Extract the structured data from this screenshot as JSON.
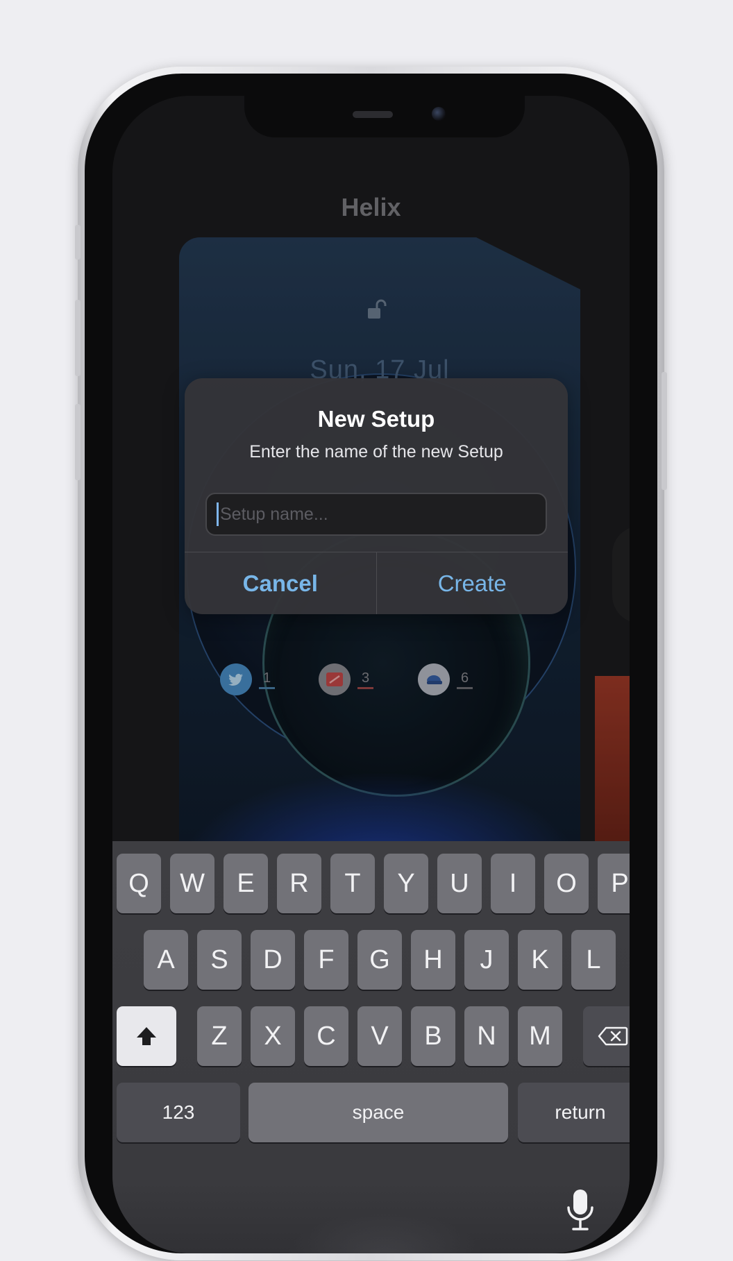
{
  "app": {
    "title": "Helix"
  },
  "lock_card": {
    "date": "Sun, 17 Jul"
  },
  "badges": [
    {
      "icon": "bird-icon",
      "count": "1",
      "color": "#5aa3dc",
      "underline": "#4a7fa8"
    },
    {
      "icon": "news-icon",
      "count": "3",
      "color": "#c84a4a",
      "underline": "#a04a4a"
    },
    {
      "icon": "browser-icon",
      "count": "6",
      "color": "#9aa6bd",
      "underline": "#6d6d72"
    }
  ],
  "dialog": {
    "title": "New Setup",
    "message": "Enter the name of the new Setup",
    "input": {
      "value": "",
      "placeholder": "Setup name..."
    },
    "cancel_label": "Cancel",
    "create_label": "Create"
  },
  "keyboard": {
    "row1": [
      "Q",
      "W",
      "E",
      "R",
      "T",
      "Y",
      "U",
      "I",
      "O",
      "P"
    ],
    "row2": [
      "A",
      "S",
      "D",
      "F",
      "G",
      "H",
      "J",
      "K",
      "L"
    ],
    "row3": [
      "Z",
      "X",
      "C",
      "V",
      "B",
      "N",
      "M"
    ],
    "numbers_label": "123",
    "space_label": "space",
    "return_label": "return",
    "shift_icon": "shift-icon",
    "delete_icon": "delete-icon",
    "mic_icon": "microphone-icon"
  },
  "colors": {
    "accent": "#78b6e8",
    "alert_bg": "#343438",
    "key": "#727278"
  }
}
